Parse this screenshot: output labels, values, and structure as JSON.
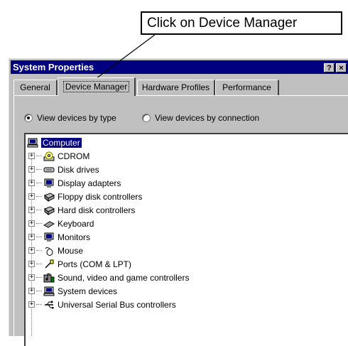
{
  "callout": {
    "text": "Click on Device Manager"
  },
  "window": {
    "title": "System Properties",
    "help_button": "?",
    "close_button": "×",
    "tabs": [
      {
        "label": "General"
      },
      {
        "label": "Device Manager",
        "active": true
      },
      {
        "label": "Hardware Profiles"
      },
      {
        "label": "Performance"
      }
    ],
    "view_options": [
      {
        "label": "View devices by type",
        "selected": true
      },
      {
        "label": "View devices by connection",
        "selected": false
      }
    ],
    "tree": {
      "root": "Computer",
      "items": [
        {
          "label": "CDROM",
          "icon": "cdrom-icon"
        },
        {
          "label": "Disk drives",
          "icon": "disk-drive-icon"
        },
        {
          "label": "Display adapters",
          "icon": "display-adapter-icon"
        },
        {
          "label": "Floppy disk controllers",
          "icon": "floppy-controller-icon"
        },
        {
          "label": "Hard disk controllers",
          "icon": "hard-disk-controller-icon"
        },
        {
          "label": "Keyboard",
          "icon": "keyboard-icon"
        },
        {
          "label": "Monitors",
          "icon": "monitor-icon"
        },
        {
          "label": "Mouse",
          "icon": "mouse-icon"
        },
        {
          "label": "Ports (COM & LPT)",
          "icon": "port-icon"
        },
        {
          "label": "Sound, video and game controllers",
          "icon": "sound-icon"
        },
        {
          "label": "System devices",
          "icon": "system-device-icon"
        },
        {
          "label": "Universal Serial Bus controllers",
          "icon": "usb-icon"
        }
      ]
    }
  },
  "colors": {
    "title_bar": "#000080",
    "face": "#c0c0c0",
    "selection": "#000080"
  }
}
